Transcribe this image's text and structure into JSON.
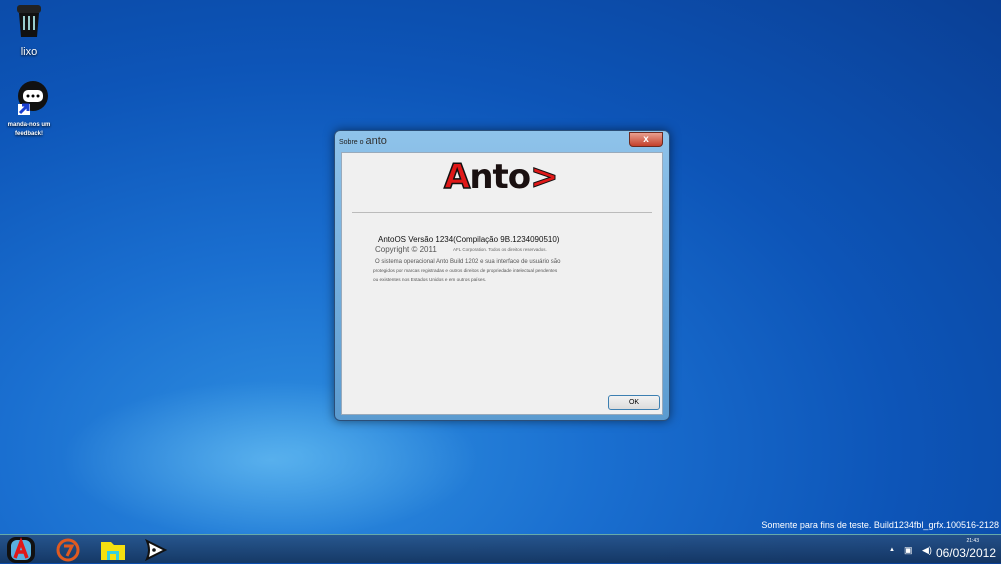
{
  "desktop": {
    "icons": [
      {
        "label": "lixo",
        "icon": "trash-icon"
      },
      {
        "label": "manda-nos um feedback!",
        "icon": "chat-bubble-icon"
      }
    ]
  },
  "dialog": {
    "title_prefix": "Sobre o",
    "title_app": "anto",
    "close_label": "x",
    "logo": "Anto>",
    "version_line": "AntoOS Versão 1234(Compilação 9B.1234090510)",
    "copyright": "Copyright © 2011",
    "rights": "AFL Corporation. Todos os direitos reservados.",
    "desc1": "O sistema operacional Anto Build 1202 e sua interface de usuário são",
    "desc2": "protegidos por marcas registradas e outros direitos de propriedade intelectual pendentes",
    "desc3": "ou existentes nos Estados Unidos e em outros países.",
    "ok_label": "OK"
  },
  "watermark": "Somente para fins de teste. Build1234fbl_grfx.100516-2128",
  "taskbar": {
    "time": "21:43",
    "date": "06/03/2012",
    "tray_arrow": "▲",
    "items": [
      "start-button",
      "browser",
      "file-explorer",
      "media-player"
    ]
  }
}
